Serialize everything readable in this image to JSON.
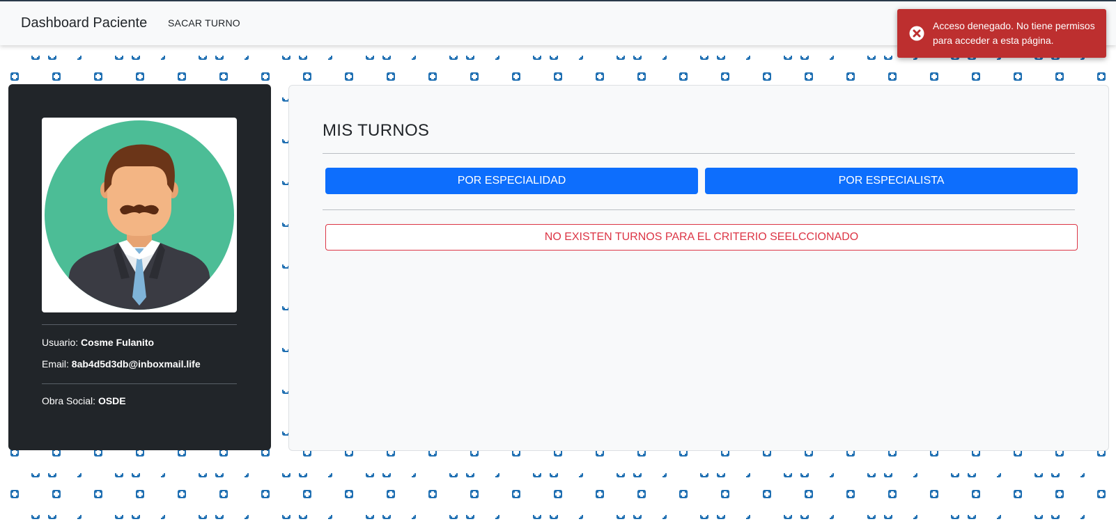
{
  "navbar": {
    "brand": "Dashboard Paciente",
    "links": [
      {
        "label": "SACAR TURNO"
      }
    ]
  },
  "toast": {
    "message": "Acceso denegado. No tiene permisos para acceder a esta página.",
    "icon": "error-circle-icon",
    "color": "#bd2f2f"
  },
  "profile": {
    "avatar_icon": "male-doctor-avatar-icon",
    "usuario_label": "Usuario: ",
    "usuario_value": "Cosme Fulanito",
    "email_label": "Email: ",
    "email_value": "8ab4d5d3db@inboxmail.life",
    "obra_social_label": "Obra Social: ",
    "obra_social_value": "OSDE"
  },
  "turnos": {
    "title": "MIS TURNOS",
    "btn_especialidad": "POR ESPECIALIDAD",
    "btn_especialista": "POR ESPECIALISTA",
    "empty_message": "NO EXISTEN TURNOS PARA EL CRITERIO SEELCCIONADO"
  },
  "colors": {
    "primary": "#0d6efd",
    "danger": "#dc3545",
    "card_dark": "#212529",
    "pattern_blue": "#1f6fb2"
  }
}
